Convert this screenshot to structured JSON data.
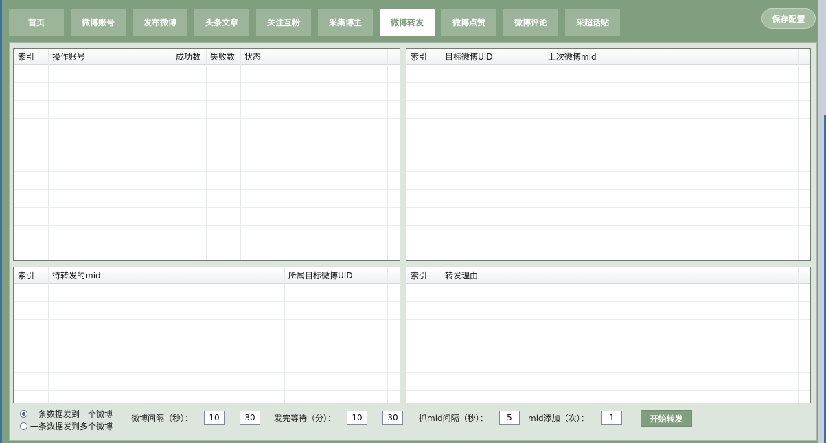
{
  "tabs": [
    {
      "label": "首页"
    },
    {
      "label": "微博账号"
    },
    {
      "label": "发布微博"
    },
    {
      "label": "头条文章"
    },
    {
      "label": "关注互粉"
    },
    {
      "label": "采集博主"
    },
    {
      "label": "微博转发",
      "active": true
    },
    {
      "label": "微博点赞"
    },
    {
      "label": "微博评论"
    },
    {
      "label": "采超话贴"
    }
  ],
  "save_config_label": "保存配置",
  "grids": {
    "accounts": {
      "columns": [
        "索引",
        "操作账号",
        "成功数",
        "失败数",
        "状态"
      ]
    },
    "targets": {
      "columns": [
        "索引",
        "目标微博UID",
        "上次微博mid"
      ]
    },
    "pending": {
      "columns": [
        "索引",
        "待转发的mid",
        "所属目标微博UID"
      ]
    },
    "reasons": {
      "columns": [
        "索引",
        "转发理由"
      ]
    }
  },
  "options": {
    "mode_one": "一条数据发到一个微博",
    "mode_many": "一条数据发到多个微博",
    "selected_mode": "mode_one"
  },
  "settings": {
    "interval_label": "微博间隔（秒）：",
    "interval_min": "10",
    "interval_max": "30",
    "wait_label": "发完等待（分）：",
    "wait_min": "10",
    "wait_max": "30",
    "mid_interval_label": "抓mid间隔（秒）：",
    "mid_interval": "5",
    "mid_add_label": "mid添加（次）：",
    "mid_add": "1",
    "dash": "—"
  },
  "start_label": "开始转发",
  "colors": {
    "theme_green": "#7f9f7f",
    "tab_green": "#9cb59a",
    "panel_bg": "#dde6dc"
  }
}
